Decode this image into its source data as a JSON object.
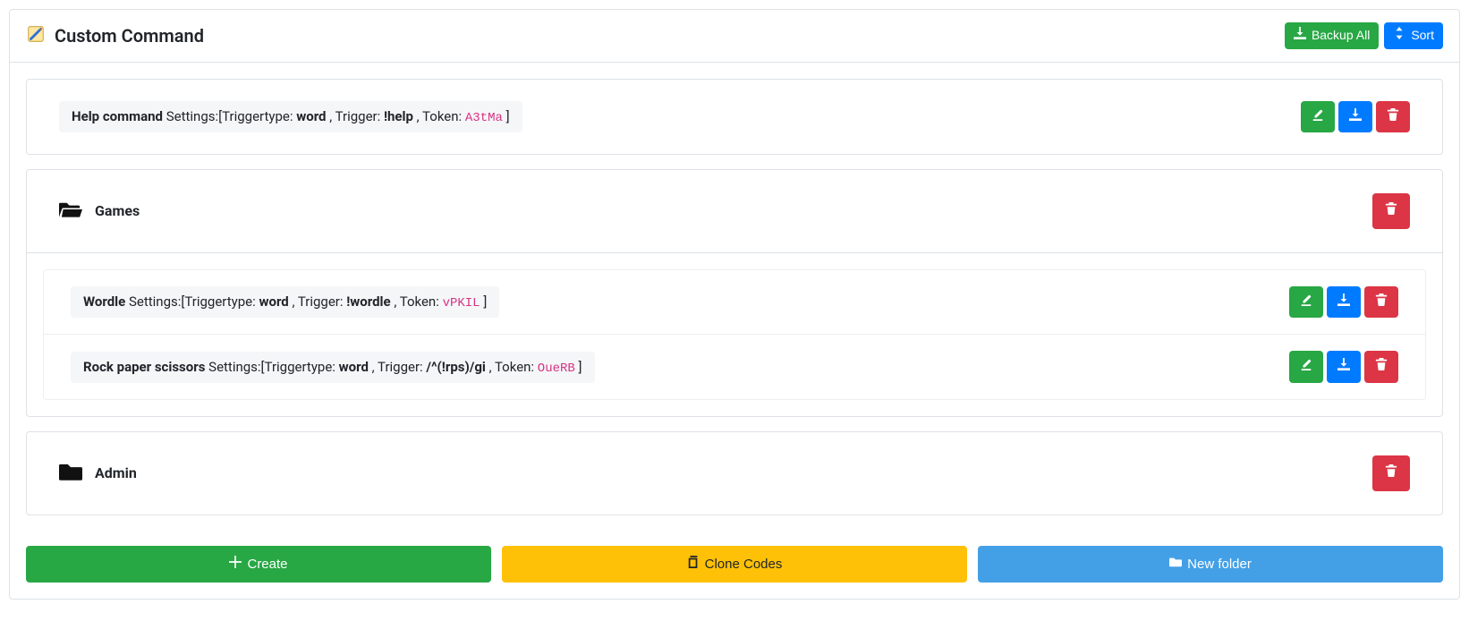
{
  "header": {
    "title": "Custom Command",
    "backup_all": "Backup All",
    "sort": "Sort"
  },
  "labels": {
    "settings_prefix": "Settings:[Triggertype: ",
    "trigger_label": " , Trigger: ",
    "token_label": " , Token: ",
    "close_bracket": " ]"
  },
  "help_command": {
    "name": "Help command",
    "trigger_type": "word",
    "trigger": "!help",
    "token": "A3tMa"
  },
  "folders": {
    "games": {
      "title": "Games",
      "open": true,
      "commands": [
        {
          "name": "Wordle",
          "trigger_type": "word",
          "trigger": "!wordle",
          "token": "vPKIL"
        },
        {
          "name": "Rock paper scissors",
          "trigger_type": "word",
          "trigger": "/^(!rps)/gi",
          "token": "OueRB"
        }
      ]
    },
    "admin": {
      "title": "Admin",
      "open": false
    }
  },
  "bottom": {
    "create": "Create",
    "clone": "Clone Codes",
    "new_folder": "New folder"
  }
}
